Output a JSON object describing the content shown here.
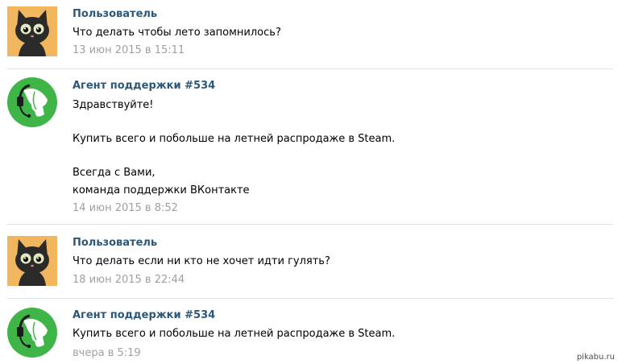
{
  "colors": {
    "author_link": "#2b587a",
    "date_text": "#a0a0a0",
    "divider": "#dae1e8",
    "support_green": "#3fb548"
  },
  "messages": [
    {
      "author": "Пользователь",
      "avatar_icon": "cat-avatar",
      "lines": [
        "Что делать чтобы лето запомнилось?"
      ],
      "date": "13 июн 2015 в 15:11"
    },
    {
      "author": "Агент поддержки #534",
      "avatar_icon": "support-agent-avatar",
      "lines": [
        "Здравствуйте!",
        "Купить всего и побольше на летней распродаже в Steam.",
        "Всегда с Вами,",
        "команда поддержки ВКонтакте"
      ],
      "date": "14 июн 2015 в 8:52"
    },
    {
      "author": "Пользователь",
      "avatar_icon": "cat-avatar",
      "lines": [
        "Что делать если ни кто не хочет идти гулять?"
      ],
      "date": "18 июн 2015 в 22:44"
    },
    {
      "author": "Агент поддержки #534",
      "avatar_icon": "support-agent-avatar",
      "lines": [
        "Купить всего и побольше на летней распродаже в Steam."
      ],
      "date": "вчера в 5:19"
    }
  ],
  "watermark": "pikabu.ru"
}
